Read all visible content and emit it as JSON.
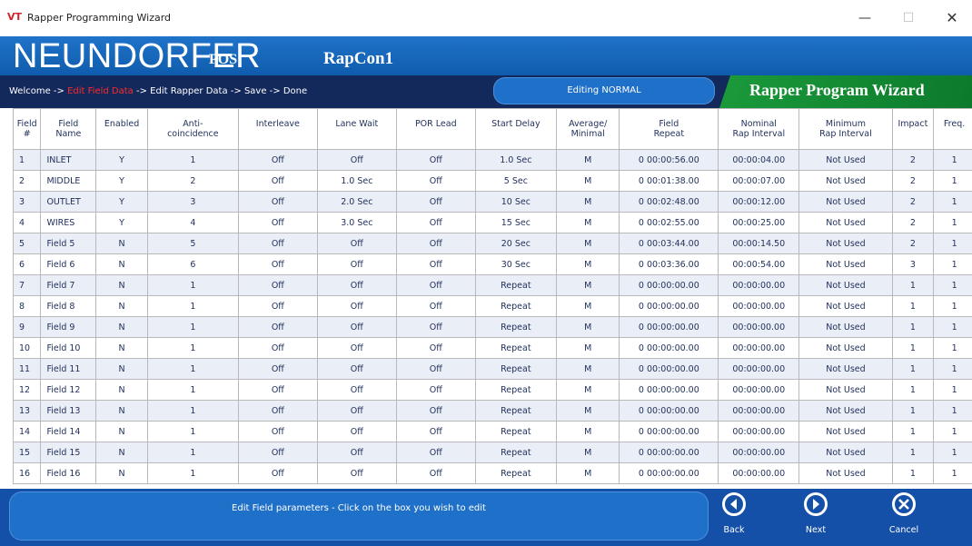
{
  "window": {
    "logo": "VT",
    "title": "Rapper Programming Wizard",
    "min_label": "—",
    "max_label": "☐",
    "close_label": "✕"
  },
  "brand": {
    "name": "NEUNDORFER",
    "sub": "POS",
    "station": "RapCon1"
  },
  "breadcrumb": {
    "step1": "Welcome",
    "sep": " -> ",
    "step2": "Edit Field Data",
    "step3": "Edit Rapper Data",
    "step4": "Save",
    "step5": "Done"
  },
  "mode": "Editing NORMAL",
  "wizard_title": "Rapper Program Wizard",
  "table": {
    "headers": [
      [
        "Field",
        "#"
      ],
      [
        "Field",
        "Name"
      ],
      [
        "Enabled",
        ""
      ],
      [
        "Anti-",
        "coincidence"
      ],
      [
        "Interleave",
        ""
      ],
      [
        "Lane Wait",
        ""
      ],
      [
        "POR Lead",
        ""
      ],
      [
        "Start Delay",
        ""
      ],
      [
        "Average/",
        "Minimal"
      ],
      [
        "Field",
        "Repeat"
      ],
      [
        "Nominal",
        "Rap Interval"
      ],
      [
        "Minimum",
        "Rap Interval"
      ],
      [
        "Impact",
        ""
      ],
      [
        "Freq.",
        ""
      ]
    ],
    "rows": [
      [
        "1",
        "INLET",
        "Y",
        "1",
        "Off",
        "Off",
        "Off",
        "1.0 Sec",
        "M",
        "0 00:00:56.00",
        "00:00:04.00",
        "Not Used",
        "2",
        "1"
      ],
      [
        "2",
        "MIDDLE",
        "Y",
        "2",
        "Off",
        "1.0 Sec",
        "Off",
        "5 Sec",
        "M",
        "0 00:01:38.00",
        "00:00:07.00",
        "Not Used",
        "2",
        "1"
      ],
      [
        "3",
        "OUTLET",
        "Y",
        "3",
        "Off",
        "2.0 Sec",
        "Off",
        "10 Sec",
        "M",
        "0 00:02:48.00",
        "00:00:12.00",
        "Not Used",
        "2",
        "1"
      ],
      [
        "4",
        "WIRES",
        "Y",
        "4",
        "Off",
        "3.0 Sec",
        "Off",
        "15 Sec",
        "M",
        "0 00:02:55.00",
        "00:00:25.00",
        "Not Used",
        "2",
        "1"
      ],
      [
        "5",
        "Field 5",
        "N",
        "5",
        "Off",
        "Off",
        "Off",
        "20 Sec",
        "M",
        "0 00:03:44.00",
        "00:00:14.50",
        "Not Used",
        "2",
        "1"
      ],
      [
        "6",
        "Field 6",
        "N",
        "6",
        "Off",
        "Off",
        "Off",
        "30 Sec",
        "M",
        "0 00:03:36.00",
        "00:00:54.00",
        "Not Used",
        "3",
        "1"
      ],
      [
        "7",
        "Field 7",
        "N",
        "1",
        "Off",
        "Off",
        "Off",
        "Repeat",
        "M",
        "0 00:00:00.00",
        "00:00:00.00",
        "Not Used",
        "1",
        "1"
      ],
      [
        "8",
        "Field 8",
        "N",
        "1",
        "Off",
        "Off",
        "Off",
        "Repeat",
        "M",
        "0 00:00:00.00",
        "00:00:00.00",
        "Not Used",
        "1",
        "1"
      ],
      [
        "9",
        "Field 9",
        "N",
        "1",
        "Off",
        "Off",
        "Off",
        "Repeat",
        "M",
        "0 00:00:00.00",
        "00:00:00.00",
        "Not Used",
        "1",
        "1"
      ],
      [
        "10",
        "Field 10",
        "N",
        "1",
        "Off",
        "Off",
        "Off",
        "Repeat",
        "M",
        "0 00:00:00.00",
        "00:00:00.00",
        "Not Used",
        "1",
        "1"
      ],
      [
        "11",
        "Field 11",
        "N",
        "1",
        "Off",
        "Off",
        "Off",
        "Repeat",
        "M",
        "0 00:00:00.00",
        "00:00:00.00",
        "Not Used",
        "1",
        "1"
      ],
      [
        "12",
        "Field 12",
        "N",
        "1",
        "Off",
        "Off",
        "Off",
        "Repeat",
        "M",
        "0 00:00:00.00",
        "00:00:00.00",
        "Not Used",
        "1",
        "1"
      ],
      [
        "13",
        "Field 13",
        "N",
        "1",
        "Off",
        "Off",
        "Off",
        "Repeat",
        "M",
        "0 00:00:00.00",
        "00:00:00.00",
        "Not Used",
        "1",
        "1"
      ],
      [
        "14",
        "Field 14",
        "N",
        "1",
        "Off",
        "Off",
        "Off",
        "Repeat",
        "M",
        "0 00:00:00.00",
        "00:00:00.00",
        "Not Used",
        "1",
        "1"
      ],
      [
        "15",
        "Field 15",
        "N",
        "1",
        "Off",
        "Off",
        "Off",
        "Repeat",
        "M",
        "0 00:00:00.00",
        "00:00:00.00",
        "Not Used",
        "1",
        "1"
      ],
      [
        "16",
        "Field 16",
        "N",
        "1",
        "Off",
        "Off",
        "Off",
        "Repeat",
        "M",
        "0 00:00:00.00",
        "00:00:00.00",
        "Not Used",
        "1",
        "1"
      ]
    ]
  },
  "hint": "Edit Field parameters - Click on the box you wish to edit",
  "nav": {
    "back": "Back",
    "next": "Next",
    "cancel": "Cancel"
  },
  "colors": {
    "brand_blue": "#1f73c9",
    "nav_dark": "#13285b",
    "wizard_green": "#1b9a3b",
    "current_step_red": "#ff2a2a"
  }
}
